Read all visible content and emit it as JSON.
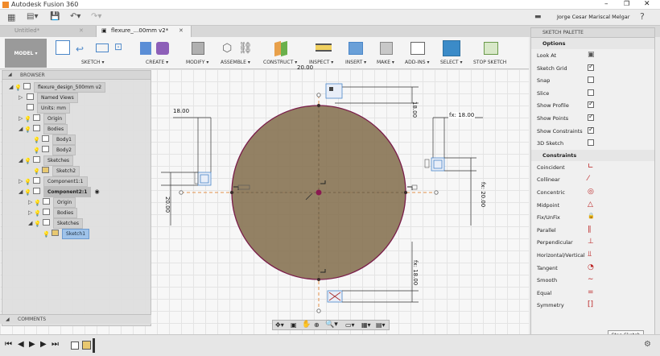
{
  "window": {
    "title": "Autodesk Fusion 360"
  },
  "appbar": {
    "user": "Jorge Cesar Mariscal Melgar"
  },
  "tabs": [
    {
      "label": "Untitled*",
      "active": false
    },
    {
      "label": "flexure_...00mm v2*",
      "active": true
    }
  ],
  "toolbar": {
    "mode": "MODEL ▾",
    "groups": [
      {
        "label": "SKETCH ▾"
      },
      {
        "label": "CREATE ▾"
      },
      {
        "label": "MODIFY ▾"
      },
      {
        "label": "ASSEMBLE ▾"
      },
      {
        "label": "CONSTRUCT ▾"
      },
      {
        "label": "INSPECT ▾"
      },
      {
        "label": "INSERT ▾"
      },
      {
        "label": "MAKE ▾"
      },
      {
        "label": "ADD-INS ▾"
      },
      {
        "label": "SELECT ▾"
      },
      {
        "label": "STOP SKETCH"
      }
    ]
  },
  "browser": {
    "title": "BROWSER",
    "items": [
      {
        "label": "flexure_design_500mm v2",
        "level": 0
      },
      {
        "label": "Named Views",
        "level": 1
      },
      {
        "label": "Units: mm",
        "level": 1
      },
      {
        "label": "Origin",
        "level": 1
      },
      {
        "label": "Bodies",
        "level": 1
      },
      {
        "label": "Body1",
        "level": 2
      },
      {
        "label": "Body2",
        "level": 2
      },
      {
        "label": "Sketches",
        "level": 1
      },
      {
        "label": "Sketch2",
        "level": 2
      },
      {
        "label": "Component1:1",
        "level": 1
      },
      {
        "label": "Component2:1",
        "level": 1
      },
      {
        "label": "Origin",
        "level": 2
      },
      {
        "label": "Bodies",
        "level": 2
      },
      {
        "label": "Sketches",
        "level": 2
      },
      {
        "label": "Sketch1",
        "level": 3
      }
    ]
  },
  "comments": {
    "title": "COMMENTS"
  },
  "palette": {
    "title": "SKETCH PALETTE",
    "options_title": "Options",
    "options": [
      {
        "label": "Look At",
        "checked": null
      },
      {
        "label": "Sketch Grid",
        "checked": true
      },
      {
        "label": "Snap",
        "checked": false
      },
      {
        "label": "Slice",
        "checked": false
      },
      {
        "label": "Show Profile",
        "checked": true
      },
      {
        "label": "Show Points",
        "checked": true
      },
      {
        "label": "Show Constraints",
        "checked": true
      },
      {
        "label": "3D Sketch",
        "checked": false
      }
    ],
    "constraints_title": "Constraints",
    "constraints": [
      {
        "label": "Coincident",
        "icon": "∟"
      },
      {
        "label": "Collinear",
        "icon": "⁄"
      },
      {
        "label": "Concentric",
        "icon": "◎"
      },
      {
        "label": "Midpoint",
        "icon": "△"
      },
      {
        "label": "Fix/UnFix",
        "icon": "🔒"
      },
      {
        "label": "Parallel",
        "icon": "∥"
      },
      {
        "label": "Perpendicular",
        "icon": "⊥"
      },
      {
        "label": "Horizontal/Vertical",
        "icon": "⫫"
      },
      {
        "label": "Tangent",
        "icon": "◔"
      },
      {
        "label": "Smooth",
        "icon": "∼"
      },
      {
        "label": "Equal",
        "icon": "="
      },
      {
        "label": "Symmetry",
        "icon": "[]"
      }
    ],
    "stop_label": "Stop Sketch"
  },
  "dimensions": {
    "top_right": "18.00",
    "top_left": "18.00",
    "right_fx": "fx: 18.00",
    "right_vert": "fx: 20.00",
    "left_vert": "20.00",
    "bottom_fx": "fx: 18.00",
    "top_clip": "20.00"
  },
  "colors": {
    "circle_fill": "#8a7657",
    "circle_stroke": "#7a1d4a",
    "construction": "#e3904b",
    "accent": "#4a86c8"
  }
}
